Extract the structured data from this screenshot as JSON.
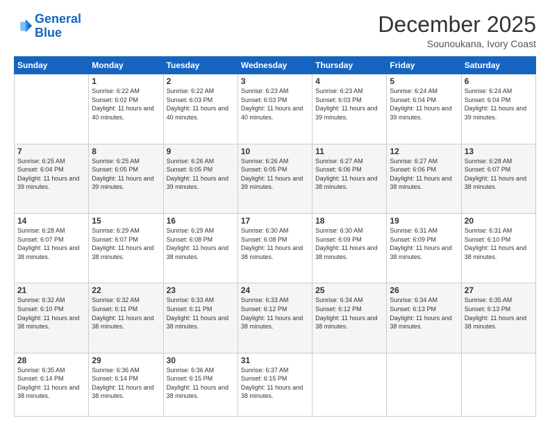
{
  "header": {
    "logo_line1": "General",
    "logo_line2": "Blue",
    "month": "December 2025",
    "location": "Sounoukana, Ivory Coast"
  },
  "weekdays": [
    "Sunday",
    "Monday",
    "Tuesday",
    "Wednesday",
    "Thursday",
    "Friday",
    "Saturday"
  ],
  "weeks": [
    [
      {
        "day": "",
        "sunrise": "",
        "sunset": "",
        "daylight": ""
      },
      {
        "day": "1",
        "sunrise": "Sunrise: 6:22 AM",
        "sunset": "Sunset: 6:02 PM",
        "daylight": "Daylight: 11 hours and 40 minutes."
      },
      {
        "day": "2",
        "sunrise": "Sunrise: 6:22 AM",
        "sunset": "Sunset: 6:03 PM",
        "daylight": "Daylight: 11 hours and 40 minutes."
      },
      {
        "day": "3",
        "sunrise": "Sunrise: 6:23 AM",
        "sunset": "Sunset: 6:03 PM",
        "daylight": "Daylight: 11 hours and 40 minutes."
      },
      {
        "day": "4",
        "sunrise": "Sunrise: 6:23 AM",
        "sunset": "Sunset: 6:03 PM",
        "daylight": "Daylight: 11 hours and 39 minutes."
      },
      {
        "day": "5",
        "sunrise": "Sunrise: 6:24 AM",
        "sunset": "Sunset: 6:04 PM",
        "daylight": "Daylight: 11 hours and 39 minutes."
      },
      {
        "day": "6",
        "sunrise": "Sunrise: 6:24 AM",
        "sunset": "Sunset: 6:04 PM",
        "daylight": "Daylight: 11 hours and 39 minutes."
      }
    ],
    [
      {
        "day": "7",
        "sunrise": "Sunrise: 6:25 AM",
        "sunset": "Sunset: 6:04 PM",
        "daylight": "Daylight: 11 hours and 39 minutes."
      },
      {
        "day": "8",
        "sunrise": "Sunrise: 6:25 AM",
        "sunset": "Sunset: 6:05 PM",
        "daylight": "Daylight: 11 hours and 39 minutes."
      },
      {
        "day": "9",
        "sunrise": "Sunrise: 6:26 AM",
        "sunset": "Sunset: 6:05 PM",
        "daylight": "Daylight: 11 hours and 39 minutes."
      },
      {
        "day": "10",
        "sunrise": "Sunrise: 6:26 AM",
        "sunset": "Sunset: 6:05 PM",
        "daylight": "Daylight: 11 hours and 39 minutes."
      },
      {
        "day": "11",
        "sunrise": "Sunrise: 6:27 AM",
        "sunset": "Sunset: 6:06 PM",
        "daylight": "Daylight: 11 hours and 38 minutes."
      },
      {
        "day": "12",
        "sunrise": "Sunrise: 6:27 AM",
        "sunset": "Sunset: 6:06 PM",
        "daylight": "Daylight: 11 hours and 38 minutes."
      },
      {
        "day": "13",
        "sunrise": "Sunrise: 6:28 AM",
        "sunset": "Sunset: 6:07 PM",
        "daylight": "Daylight: 11 hours and 38 minutes."
      }
    ],
    [
      {
        "day": "14",
        "sunrise": "Sunrise: 6:28 AM",
        "sunset": "Sunset: 6:07 PM",
        "daylight": "Daylight: 11 hours and 38 minutes."
      },
      {
        "day": "15",
        "sunrise": "Sunrise: 6:29 AM",
        "sunset": "Sunset: 6:07 PM",
        "daylight": "Daylight: 11 hours and 38 minutes."
      },
      {
        "day": "16",
        "sunrise": "Sunrise: 6:29 AM",
        "sunset": "Sunset: 6:08 PM",
        "daylight": "Daylight: 11 hours and 38 minutes."
      },
      {
        "day": "17",
        "sunrise": "Sunrise: 6:30 AM",
        "sunset": "Sunset: 6:08 PM",
        "daylight": "Daylight: 11 hours and 38 minutes."
      },
      {
        "day": "18",
        "sunrise": "Sunrise: 6:30 AM",
        "sunset": "Sunset: 6:09 PM",
        "daylight": "Daylight: 11 hours and 38 minutes."
      },
      {
        "day": "19",
        "sunrise": "Sunrise: 6:31 AM",
        "sunset": "Sunset: 6:09 PM",
        "daylight": "Daylight: 11 hours and 38 minutes."
      },
      {
        "day": "20",
        "sunrise": "Sunrise: 6:31 AM",
        "sunset": "Sunset: 6:10 PM",
        "daylight": "Daylight: 11 hours and 38 minutes."
      }
    ],
    [
      {
        "day": "21",
        "sunrise": "Sunrise: 6:32 AM",
        "sunset": "Sunset: 6:10 PM",
        "daylight": "Daylight: 11 hours and 38 minutes."
      },
      {
        "day": "22",
        "sunrise": "Sunrise: 6:32 AM",
        "sunset": "Sunset: 6:11 PM",
        "daylight": "Daylight: 11 hours and 38 minutes."
      },
      {
        "day": "23",
        "sunrise": "Sunrise: 6:33 AM",
        "sunset": "Sunset: 6:11 PM",
        "daylight": "Daylight: 11 hours and 38 minutes."
      },
      {
        "day": "24",
        "sunrise": "Sunrise: 6:33 AM",
        "sunset": "Sunset: 6:12 PM",
        "daylight": "Daylight: 11 hours and 38 minutes."
      },
      {
        "day": "25",
        "sunrise": "Sunrise: 6:34 AM",
        "sunset": "Sunset: 6:12 PM",
        "daylight": "Daylight: 11 hours and 38 minutes."
      },
      {
        "day": "26",
        "sunrise": "Sunrise: 6:34 AM",
        "sunset": "Sunset: 6:13 PM",
        "daylight": "Daylight: 11 hours and 38 minutes."
      },
      {
        "day": "27",
        "sunrise": "Sunrise: 6:35 AM",
        "sunset": "Sunset: 6:13 PM",
        "daylight": "Daylight: 11 hours and 38 minutes."
      }
    ],
    [
      {
        "day": "28",
        "sunrise": "Sunrise: 6:35 AM",
        "sunset": "Sunset: 6:14 PM",
        "daylight": "Daylight: 11 hours and 38 minutes."
      },
      {
        "day": "29",
        "sunrise": "Sunrise: 6:36 AM",
        "sunset": "Sunset: 6:14 PM",
        "daylight": "Daylight: 11 hours and 38 minutes."
      },
      {
        "day": "30",
        "sunrise": "Sunrise: 6:36 AM",
        "sunset": "Sunset: 6:15 PM",
        "daylight": "Daylight: 11 hours and 38 minutes."
      },
      {
        "day": "31",
        "sunrise": "Sunrise: 6:37 AM",
        "sunset": "Sunset: 6:15 PM",
        "daylight": "Daylight: 11 hours and 38 minutes."
      },
      {
        "day": "",
        "sunrise": "",
        "sunset": "",
        "daylight": ""
      },
      {
        "day": "",
        "sunrise": "",
        "sunset": "",
        "daylight": ""
      },
      {
        "day": "",
        "sunrise": "",
        "sunset": "",
        "daylight": ""
      }
    ]
  ]
}
